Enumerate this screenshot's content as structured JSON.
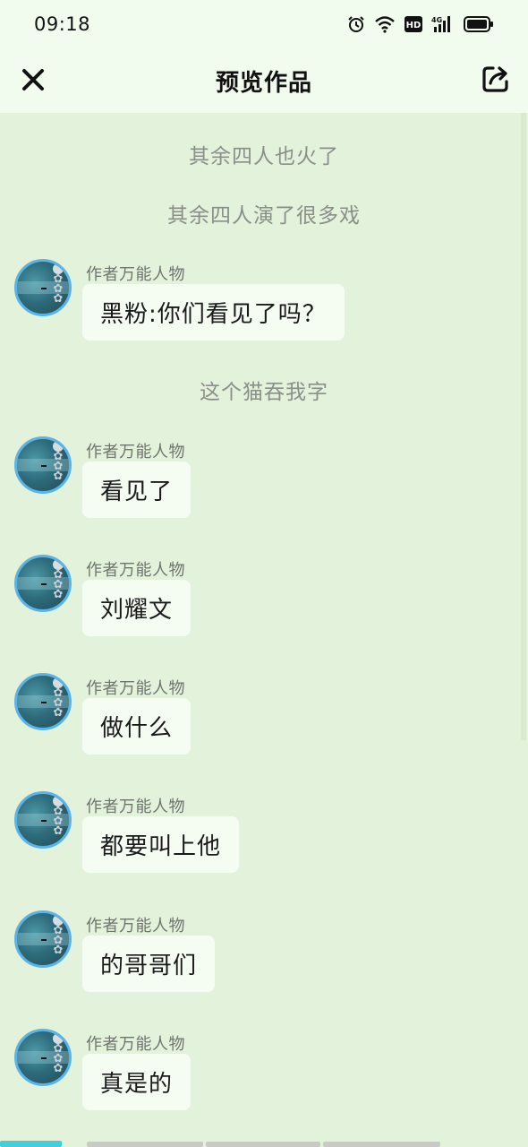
{
  "status_bar": {
    "time": "09:18"
  },
  "nav": {
    "title": "预览作品"
  },
  "narrations": [
    {
      "text": "其余四人也火了"
    },
    {
      "text": "其余四人演了很多戏"
    },
    {
      "text": "这个猫吞我字"
    }
  ],
  "messages": [
    {
      "author": "作者万能人物",
      "text": "黑粉:你们看见了吗？"
    },
    {
      "author": "作者万能人物",
      "text": "看见了"
    },
    {
      "author": "作者万能人物",
      "text": "刘耀文"
    },
    {
      "author": "作者万能人物",
      "text": "做什么"
    },
    {
      "author": "作者万能人物",
      "text": "都要叫上他"
    },
    {
      "author": "作者万能人物",
      "text": "的哥哥们"
    },
    {
      "author": "作者万能人物",
      "text": "真是的"
    }
  ],
  "progress": {
    "current_segment": 1,
    "total_segments": 5
  },
  "colors": {
    "background": "#e3f2da",
    "header": "#f1fbee",
    "bubble": "#f5fdf3",
    "avatar_border": "#5bb4e8",
    "progress_active": "#3fd0db"
  },
  "icons": [
    "close-icon",
    "share-icon",
    "alarm-icon",
    "wifi-icon",
    "hd-icon",
    "signal-4g-icon",
    "battery-icon"
  ]
}
